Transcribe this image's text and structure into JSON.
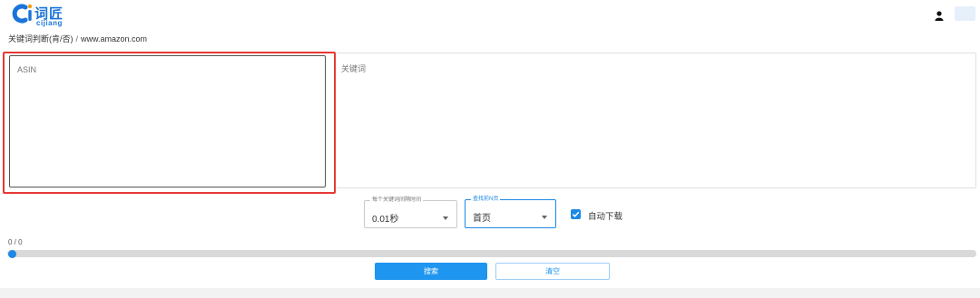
{
  "logo": {
    "brand_text": "词匠",
    "sub_text": "cijiang"
  },
  "header": {
    "user_icon": "user-icon"
  },
  "breadcrumb": {
    "page": "关键词判断(肯/否)",
    "separator": "/",
    "site": "www.amazon.com"
  },
  "inputs": {
    "asin_placeholder": "ASIN",
    "keywords_placeholder": "关键词"
  },
  "options": {
    "interval": {
      "label": "每个关键词间隔时间",
      "value": "0.01秒"
    },
    "pages": {
      "label": "查找前N页",
      "value": "首页"
    },
    "auto_download": {
      "label": "自动下载",
      "checked": true
    }
  },
  "progress": {
    "text": "0 / 0",
    "value": 0
  },
  "buttons": {
    "search": "搜索",
    "clear": "清空"
  },
  "colors": {
    "accent": "#1e88e5",
    "highlight": "#e53935"
  }
}
